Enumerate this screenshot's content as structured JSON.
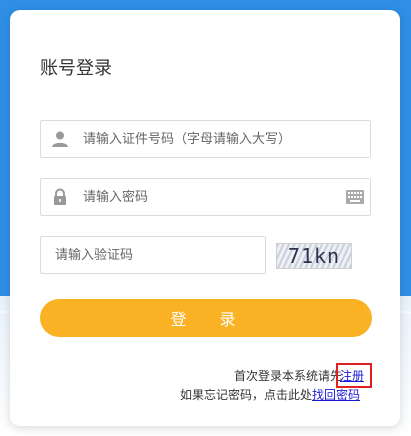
{
  "login": {
    "title": "账号登录",
    "id_placeholder": "请输入证件号码（字母请输入大写）",
    "password_placeholder": "请输入密码",
    "captcha_placeholder": "请输入验证码",
    "captcha_text": "71kn",
    "submit_label": "登 录"
  },
  "links": {
    "register_prefix": "首次登录本系统请先",
    "register_label": "注册",
    "forgot_prefix": "如果忘记密码，点击此处",
    "forgot_label": "找回密码"
  },
  "colors": {
    "background": "#2f8fe6",
    "button": "#fbb124",
    "link": "#1a1ad6",
    "highlight": "#e02020"
  }
}
